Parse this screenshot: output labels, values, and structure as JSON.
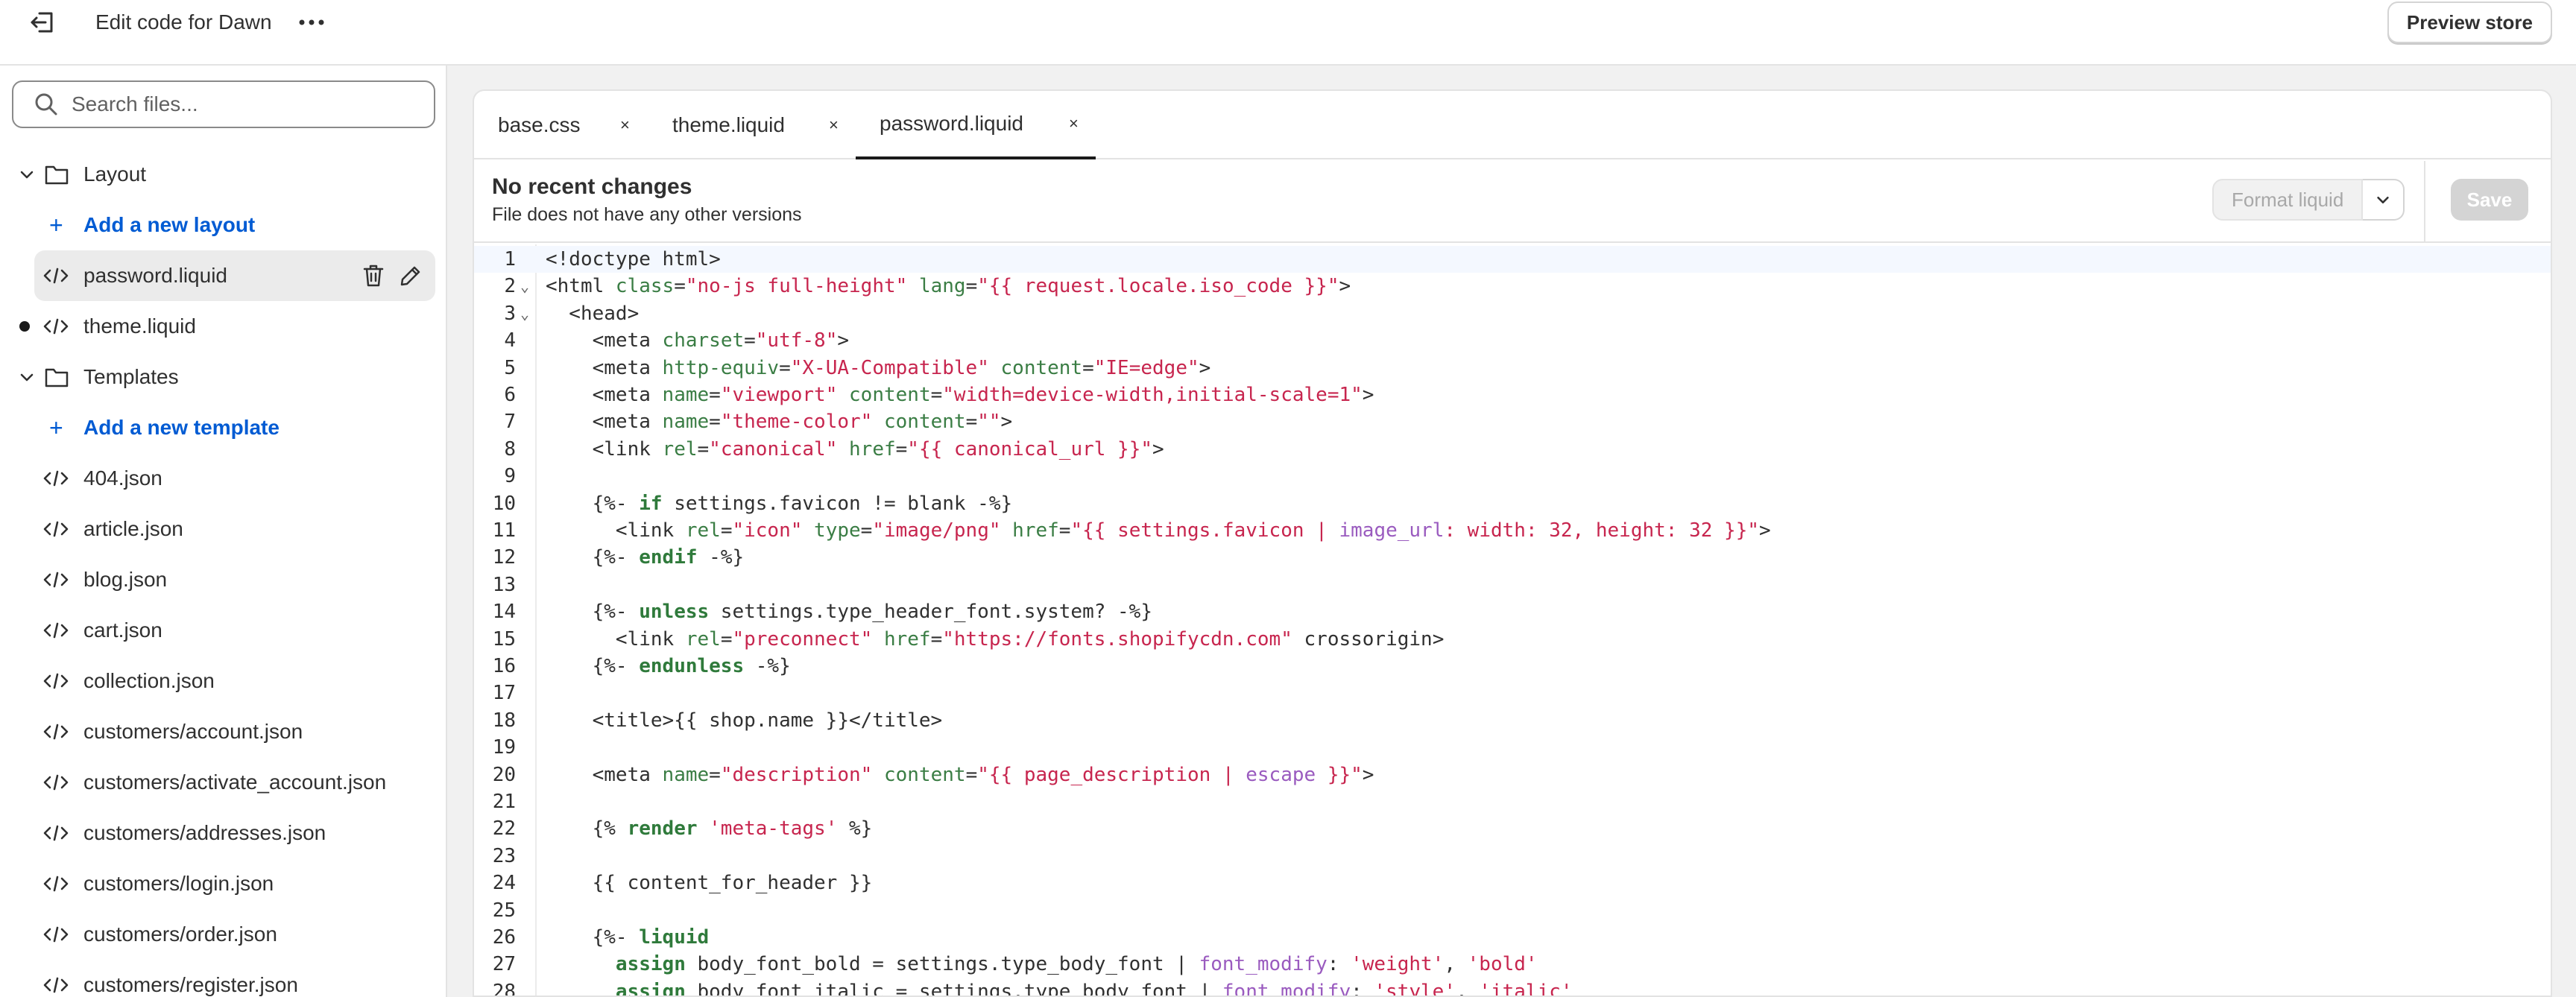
{
  "header": {
    "title": "Edit code for Dawn",
    "preview_label": "Preview store"
  },
  "sidebar": {
    "search_placeholder": "Search files...",
    "layout_folder": "Layout",
    "add_layout": "Add a new layout",
    "layout_files": [
      "password.liquid",
      "theme.liquid"
    ],
    "templates_folder": "Templates",
    "add_template": "Add a new template",
    "template_files": [
      "404.json",
      "article.json",
      "blog.json",
      "cart.json",
      "collection.json",
      "customers/account.json",
      "customers/activate_account.json",
      "customers/addresses.json",
      "customers/login.json",
      "customers/order.json",
      "customers/register.json"
    ]
  },
  "tabs": [
    {
      "label": "base.css",
      "close": "×"
    },
    {
      "label": "theme.liquid",
      "close": "×"
    },
    {
      "label": "password.liquid",
      "close": "×"
    }
  ],
  "status": {
    "title": "No recent changes",
    "subtitle": "File does not have any other versions",
    "format_label": "Format liquid",
    "save_label": "Save"
  },
  "code_lines": [
    "<!doctype html>",
    "<html class=\"no-js full-height\" lang=\"{{ request.locale.iso_code }}\">",
    "  <head>",
    "    <meta charset=\"utf-8\">",
    "    <meta http-equiv=\"X-UA-Compatible\" content=\"IE=edge\">",
    "    <meta name=\"viewport\" content=\"width=device-width,initial-scale=1\">",
    "    <meta name=\"theme-color\" content=\"\">",
    "    <link rel=\"canonical\" href=\"{{ canonical_url }}\">",
    "",
    "    {%- if settings.favicon != blank -%}",
    "      <link rel=\"icon\" type=\"image/png\" href=\"{{ settings.favicon | image_url: width: 32, height: 32 }}\">",
    "    {%- endif -%}",
    "",
    "    {%- unless settings.type_header_font.system? -%}",
    "      <link rel=\"preconnect\" href=\"https://fonts.shopifycdn.com\" crossorigin>",
    "    {%- endunless -%}",
    "",
    "    <title>{{ shop.name }}</title>",
    "",
    "    <meta name=\"description\" content=\"{{ page_description | escape }}\">",
    "",
    "    {% render 'meta-tags' %}",
    "",
    "    {{ content_for_header }}",
    "",
    "    {%- liquid",
    "      assign body_font_bold = settings.type_body_font | font_modify: 'weight', 'bold'",
    "      assign body_font_italic = settings.type_body_font | font_modify: 'style', 'italic'"
  ],
  "colors": {
    "accent": "#005bd3",
    "string": "#c7254e",
    "attribute": "#3a7d44",
    "liquid": "#1f3a8a",
    "filter": "#9a5bbf"
  }
}
